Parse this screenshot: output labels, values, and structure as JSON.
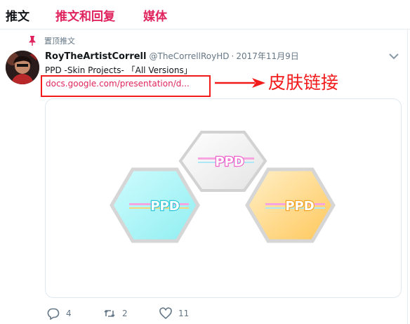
{
  "tabs": [
    {
      "label": "推文"
    },
    {
      "label": "推文和回复"
    },
    {
      "label": "媒体"
    }
  ],
  "pinned_label": "置顶推文",
  "tweet": {
    "name": "RoyTheArtistCorrell",
    "handle": "@TheCorrellRoyHD",
    "separator": "·",
    "date": "2017年11月9日",
    "text": "PPD -Skin Projects- 「All Versions」",
    "link_text": "docs.google.com/presentation/d...",
    "annotation": "皮肤链接"
  },
  "card": {
    "logos": [
      {
        "text": "PPD",
        "color": "#ee66cc"
      },
      {
        "text": "PPD",
        "color": "#33c9d8"
      },
      {
        "text": "PPD",
        "color": "#f2a628"
      }
    ]
  },
  "actions": {
    "reply_count": "4",
    "retweet_count": "2",
    "like_count": "11"
  },
  "colors": {
    "accent": "#e0245e",
    "annotation_red": "#f21b1b",
    "muted": "#657786"
  }
}
